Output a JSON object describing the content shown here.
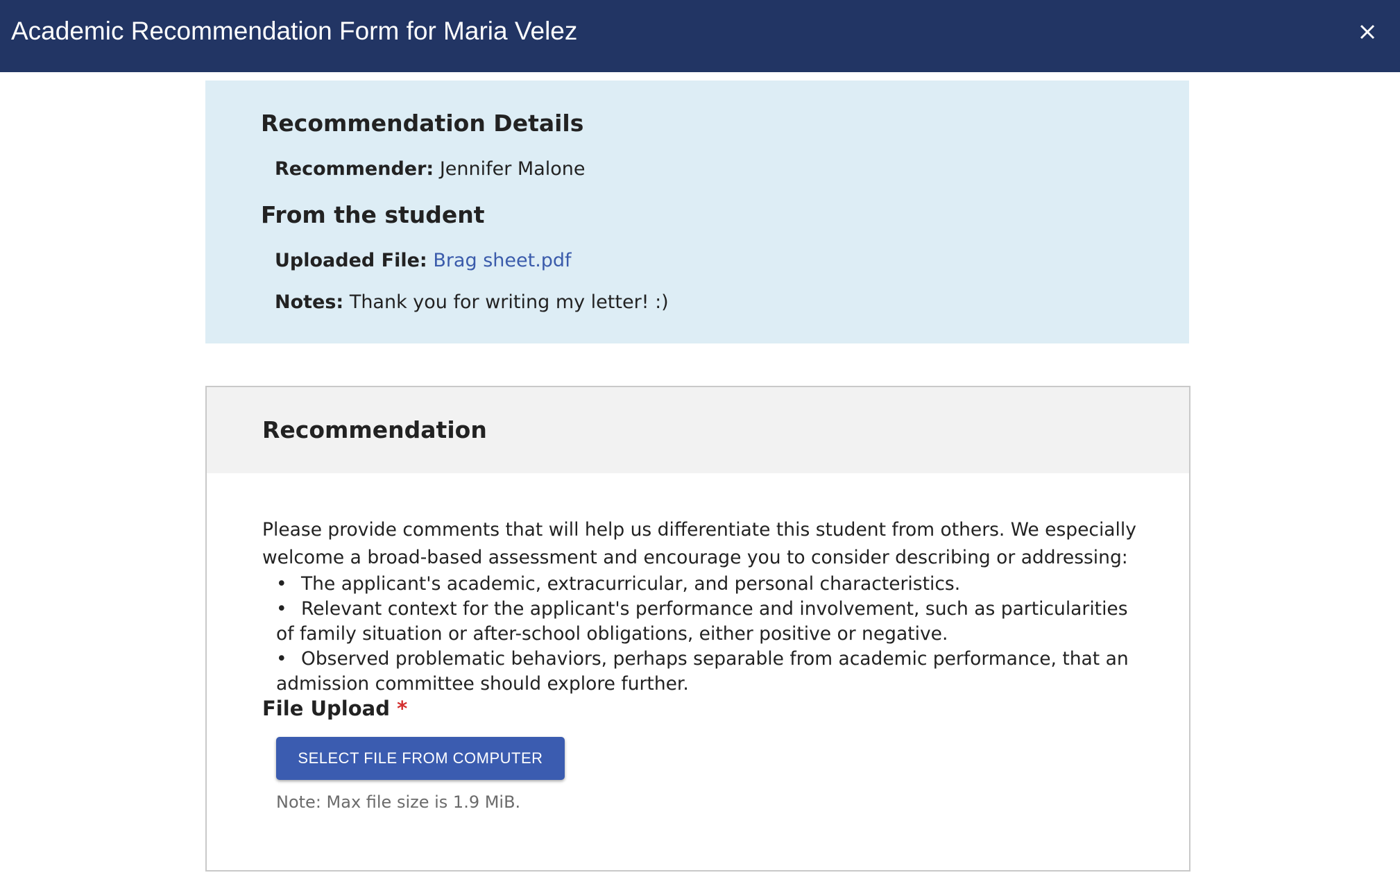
{
  "header": {
    "title": "Academic Recommendation Form for Maria Velez",
    "close_icon": "close-icon",
    "background_color": "#223564"
  },
  "details": {
    "heading": "Recommendation Details",
    "recommender_label": "Recommender:",
    "recommender_value": "Jennifer Malone",
    "student_heading": "From the student",
    "uploaded_file_label": "Uploaded File:",
    "uploaded_file_link": "Brag sheet.pdf",
    "notes_label": "Notes:",
    "notes_value": "Thank you for writing my letter! :)"
  },
  "recommendation": {
    "title": "Recommendation",
    "intro": "Please provide comments that will help us differentiate this student from others. We especially welcome a broad-based assessment and encourage you to consider describing or addressing:",
    "bullets": [
      "The applicant's academic, extracurricular, and personal characteristics.",
      "Relevant context for the applicant's performance and involvement, such as particularities of family situation or after-school obligations, either positive or negative.",
      "Observed problematic behaviors, perhaps separable from academic performance, that an admission committee should explore further."
    ],
    "upload_label": "File Upload",
    "required_marker": "*",
    "upload_button": "SELECT FILE FROM COMPUTER",
    "note": "Note: Max file size is 1.9 MiB."
  },
  "colors": {
    "accent": "#3b5cb0",
    "link": "#3a5bab",
    "panel": "#ddedf5",
    "required": "#d32f2f"
  }
}
